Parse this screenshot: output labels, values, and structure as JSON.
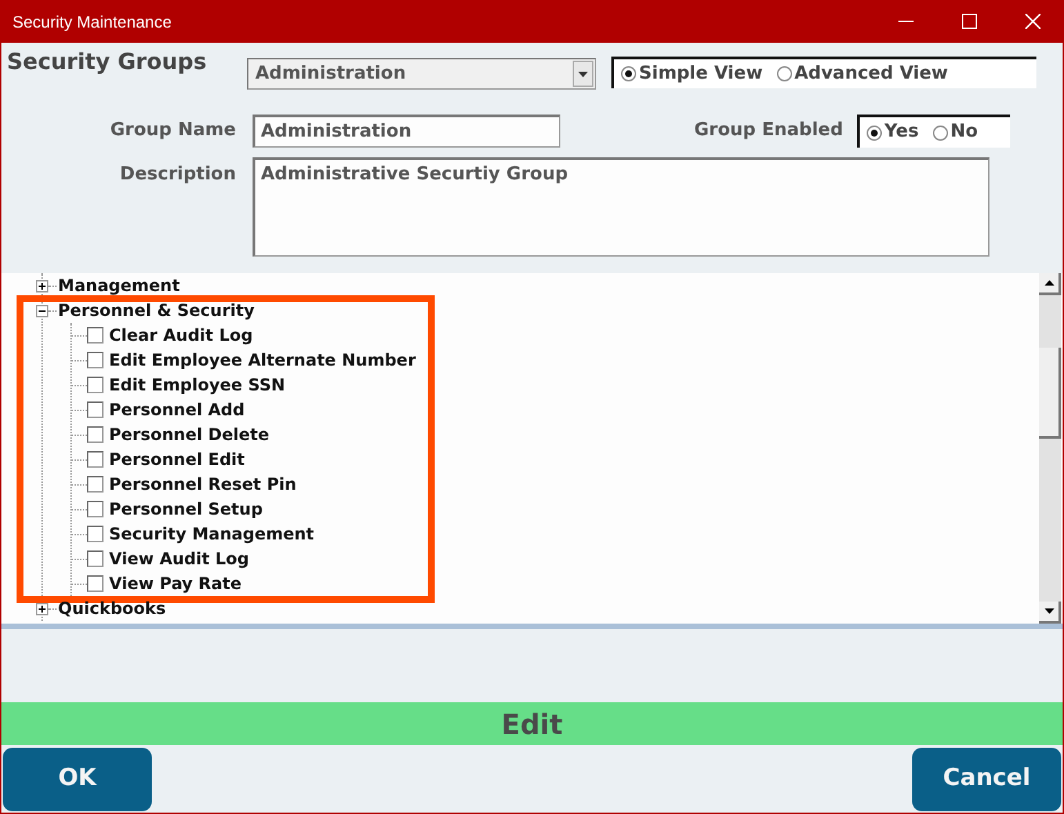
{
  "window": {
    "title": "Security Maintenance"
  },
  "heading": "Security Groups",
  "group_select": {
    "value": "Administration"
  },
  "view_options": [
    {
      "label": "Simple View",
      "selected": true
    },
    {
      "label": "Advanced View",
      "selected": false
    }
  ],
  "group_name": {
    "label": "Group Name",
    "value": "Administration"
  },
  "group_enabled": {
    "label": "Group Enabled",
    "options": [
      {
        "label": "Yes",
        "selected": true
      },
      {
        "label": "No",
        "selected": false
      }
    ]
  },
  "description": {
    "label": "Description",
    "value": "Administrative Securtiy Group"
  },
  "tree": [
    {
      "label": "Management",
      "expanded": false
    },
    {
      "label": "Personnel & Security",
      "expanded": true,
      "highlighted": true,
      "children": [
        {
          "label": "Clear Audit Log",
          "checked": false
        },
        {
          "label": "Edit Employee Alternate Number",
          "checked": false
        },
        {
          "label": "Edit Employee SSN",
          "checked": false
        },
        {
          "label": "Personnel Add",
          "checked": false
        },
        {
          "label": "Personnel Delete",
          "checked": false
        },
        {
          "label": "Personnel Edit",
          "checked": false
        },
        {
          "label": "Personnel Reset Pin",
          "checked": false
        },
        {
          "label": "Personnel Setup",
          "checked": false
        },
        {
          "label": "Security Management",
          "checked": false
        },
        {
          "label": "View Audit Log",
          "checked": false
        },
        {
          "label": "View Pay Rate",
          "checked": false
        }
      ]
    },
    {
      "label": "Quickbooks",
      "expanded": false
    }
  ],
  "mode": "Edit",
  "buttons": [
    "OK",
    "Cancel"
  ]
}
